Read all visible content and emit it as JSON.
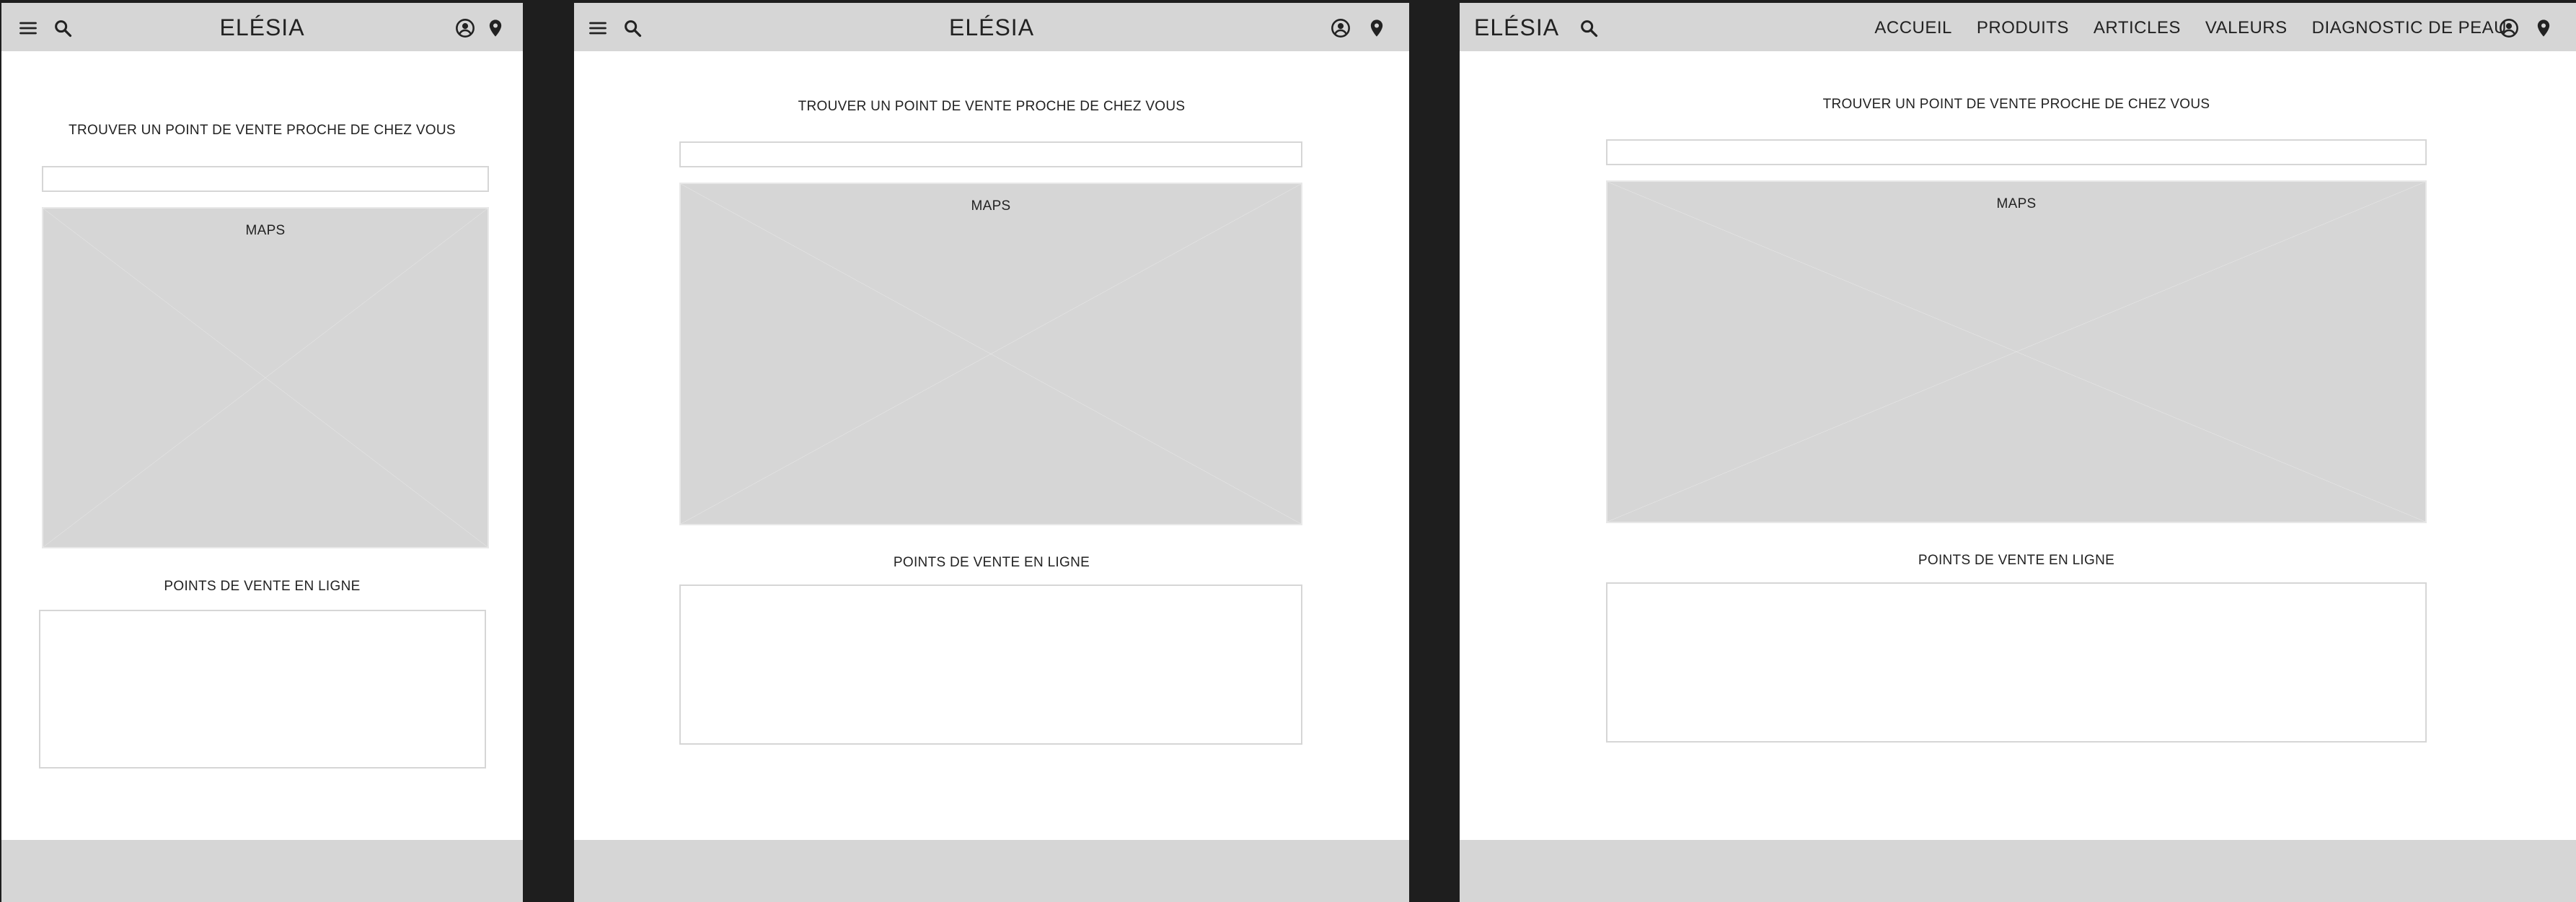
{
  "brand": "ELÉSIA",
  "store_locator_title": "TROUVER UN POINT DE VENTE PROCHE DE CHEZ VOUS",
  "map_label": "MAPS",
  "online_title": "POINTS DE VENTE EN LIGNE",
  "nav": [
    "ACCUEIL",
    "PRODUITS",
    "ARTICLES",
    "VALEURS",
    "DIAGNOSTIC DE PEAU"
  ],
  "icons": {
    "menu": "menu-icon",
    "search": "search-icon",
    "account": "account-icon",
    "location": "location-pin-icon"
  },
  "colors": {
    "header": "#d6d6d6",
    "gutter": "#1e1e1e",
    "placeholder": "#d6d6d6",
    "page": "#ffffff"
  }
}
